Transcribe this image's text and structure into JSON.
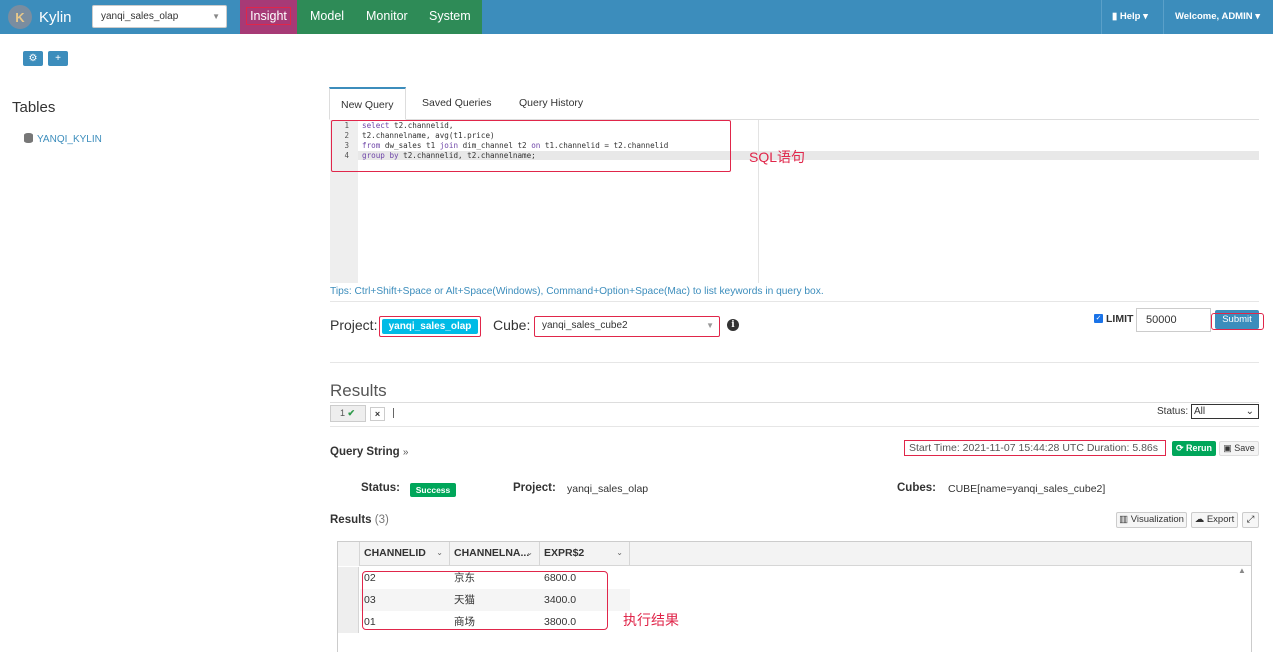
{
  "app": {
    "brand": "Kylin",
    "project_select": "yanqi_sales_olap"
  },
  "nav": {
    "items": [
      "Insight",
      "Model",
      "Monitor",
      "System"
    ],
    "help": "Help",
    "welcome": "Welcome, ADMIN"
  },
  "sidebar": {
    "title": "Tables",
    "databases": [
      "YANQI_KYLIN"
    ]
  },
  "query_tabs": [
    "New Query",
    "Saved Queries",
    "Query History"
  ],
  "editor": {
    "line_numbers": [
      "1",
      "2",
      "3",
      "4"
    ],
    "lines": [
      "select t2.channelid,",
      "t2.channelname, avg(t1.price)",
      "from dw_sales t1 join dim_channel t2 on t1.channelid = t2.channelid",
      "group by t2.channelid, t2.channelname;"
    ],
    "annotation": "SQL语句"
  },
  "tips": "Tips: Ctrl+Shift+Space or Alt+Space(Windows), Command+Option+Space(Mac) to list keywords in query box.",
  "query_form": {
    "project_label": "Project:",
    "project_value": "yanqi_sales_olap",
    "cube_label": "Cube:",
    "cube_value": "yanqi_sales_cube2",
    "limit_label": "LIMIT",
    "limit_checked": true,
    "limit_value": "50000",
    "submit_label": "Submit"
  },
  "results": {
    "title": "Results",
    "tab_number": "1",
    "status_label": "Status:",
    "status_value": "All",
    "query_string_label": "Query String",
    "start_time": "Start Time: 2021-11-07 15:44:28 UTC   Duration: 5.86s",
    "rerun_label": "Rerun",
    "save_label": "Save",
    "status_field_label": "Status:",
    "status_badge": "Success",
    "project_field_label": "Project:",
    "project_field_value": "yanqi_sales_olap",
    "cubes_field_label": "Cubes:",
    "cubes_field_value": "CUBE[name=yanqi_sales_cube2]",
    "results_label": "Results",
    "results_count": "(3)",
    "visualization_label": "Visualization",
    "export_label": "Export",
    "columns": [
      "CHANNELID",
      "CHANNELNA...",
      "EXPR$2"
    ],
    "rows": [
      [
        "02",
        "京东",
        "6800.0"
      ],
      [
        "03",
        "天猫",
        "3400.0"
      ],
      [
        "01",
        "商场",
        "3800.0"
      ]
    ],
    "annotation": "执行结果"
  },
  "colors": {
    "navbar": "#3c8dbc",
    "nav_green": "#2e8b57",
    "insight_active": "#a73a76",
    "annotation_red": "#e0264a",
    "success": "#00a65a",
    "badge": "#00bbe6"
  }
}
